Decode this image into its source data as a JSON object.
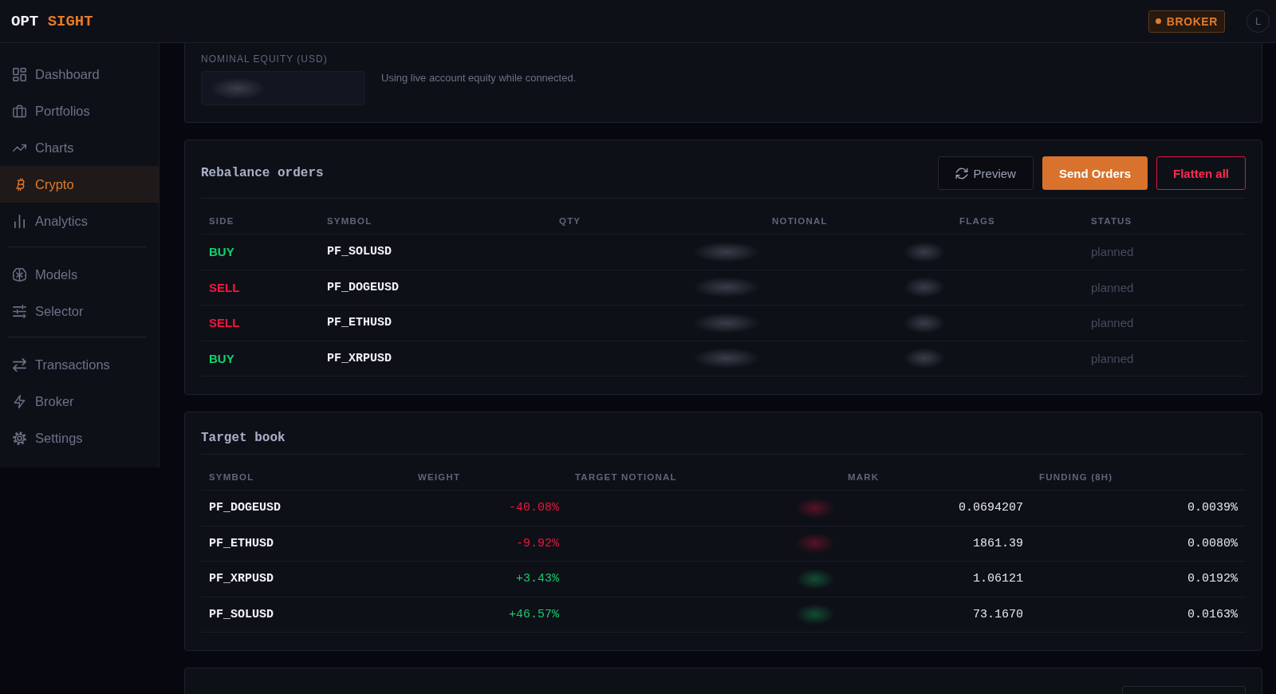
{
  "top_bar": {
    "logo": {
      "text": "OPT",
      "accent": "SIGHT"
    },
    "badge": {
      "label": "BROKER"
    },
    "avatar": {
      "initial": "L"
    }
  },
  "sidebar": {
    "sections": [
      {
        "items": [
          {
            "label": "Dashboard",
            "selected": false
          },
          {
            "label": "Portfolios",
            "selected": false
          },
          {
            "label": "Charts",
            "selected": false
          },
          {
            "label": "Crypto",
            "selected": true
          },
          {
            "label": "Analytics",
            "selected": false
          }
        ]
      },
      {
        "items": [
          {
            "label": "Models",
            "selected": false
          },
          {
            "label": "Selector",
            "selected": false
          }
        ]
      },
      {
        "items": [
          {
            "label": "Transactions",
            "selected": false
          },
          {
            "label": "Broker",
            "selected": false
          },
          {
            "label": "Settings",
            "selected": false
          }
        ]
      }
    ]
  },
  "equity_panel": {
    "label": "NOMINAL EQUITY (USD)",
    "note": "Using live account equity while connected."
  },
  "rebalance_orders": {
    "title": "Rebalance orders",
    "buttons": [
      {
        "label": "Preview",
        "kind": "secondary"
      },
      {
        "label": "Send Orders",
        "kind": "primary"
      },
      {
        "label": "Flatten all",
        "kind": "danger"
      }
    ],
    "columns": [
      "SIDE",
      "SYMBOL",
      "QTY",
      "NOTIONAL",
      "FLAGS",
      "STATUS"
    ],
    "rows": [
      {
        "side": "BUY",
        "color": "#12d46b",
        "symbol": "PF_SOLUSD",
        "status": "planned"
      },
      {
        "side": "SELL",
        "color": "#f5163f",
        "symbol": "PF_DOGEUSD",
        "status": "planned"
      },
      {
        "side": "SELL",
        "color": "#f5163f",
        "symbol": "PF_ETHUSD",
        "status": "planned"
      },
      {
        "side": "BUY",
        "color": "#12d46b",
        "symbol": "PF_XRPUSD",
        "status": "planned"
      }
    ]
  },
  "target_book": {
    "title": "Target book",
    "columns": [
      "SYMBOL",
      "WEIGHT",
      "TARGET NOTIONAL",
      "MARK",
      "FUNDING (8H)"
    ],
    "rows": [
      {
        "symbol": "PF_DOGEUSD",
        "weight": "-40.08%",
        "color": "#e8173d",
        "mark": "0.0694207",
        "funding": "0.0039%"
      },
      {
        "symbol": "PF_ETHUSD",
        "weight": "-9.92%",
        "color": "#e8173d",
        "mark": "1861.39",
        "funding": "0.0080%"
      },
      {
        "symbol": "PF_XRPUSD",
        "weight": "+3.43%",
        "color": "#1cc96a",
        "mark": "1.06121",
        "funding": "0.0192%"
      },
      {
        "symbol": "PF_SOLUSD",
        "weight": "+46.57%",
        "color": "#1cc96a",
        "mark": "73.1670",
        "funding": "0.0163%"
      }
    ]
  }
}
